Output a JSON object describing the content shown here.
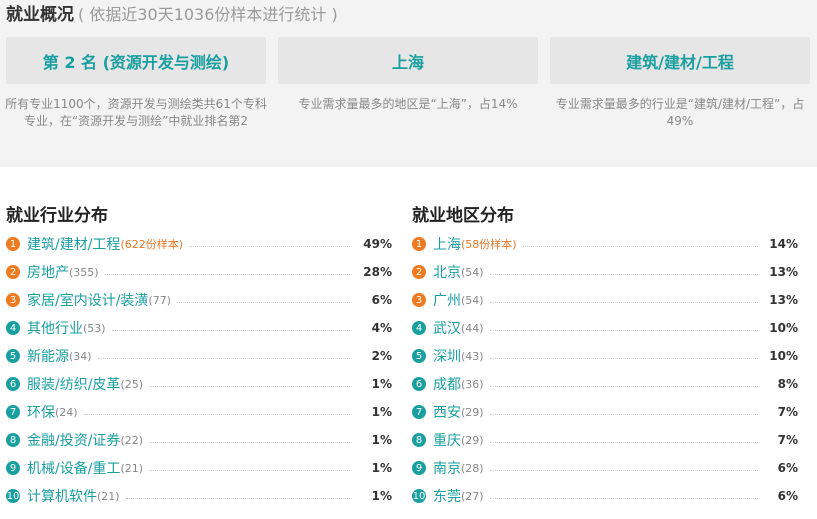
{
  "header": {
    "title": "就业概况",
    "subtitle": "( 依据近30天1036份样本进行统计 )"
  },
  "cards": [
    {
      "label": "第 2 名 (资源开发与测绘)",
      "desc": "所有专业1100个，资源开发与测绘类共61个专科专业，在“资源开发与测绘”中就业排名第2"
    },
    {
      "label": "上海",
      "desc": "专业需求量最多的地区是“上海”，占14%"
    },
    {
      "label": "建筑/建材/工程",
      "desc": "专业需求量最多的行业是“建筑/建材/工程”，占49%"
    }
  ],
  "industry": {
    "title": "就业行业分布",
    "items": [
      {
        "rank": "1",
        "name": "建筑/建材/工程",
        "count": "(622份样本)",
        "pct": "49%"
      },
      {
        "rank": "2",
        "name": "房地产",
        "count": "(355)",
        "pct": "28%"
      },
      {
        "rank": "3",
        "name": "家居/室内设计/装潢",
        "count": "(77)",
        "pct": "6%"
      },
      {
        "rank": "4",
        "name": "其他行业",
        "count": "(53)",
        "pct": "4%"
      },
      {
        "rank": "5",
        "name": "新能源",
        "count": "(34)",
        "pct": "2%"
      },
      {
        "rank": "6",
        "name": "服装/纺织/皮革",
        "count": "(25)",
        "pct": "1%"
      },
      {
        "rank": "7",
        "name": "环保",
        "count": "(24)",
        "pct": "1%"
      },
      {
        "rank": "8",
        "name": "金融/投资/证券",
        "count": "(22)",
        "pct": "1%"
      },
      {
        "rank": "9",
        "name": "机械/设备/重工",
        "count": "(21)",
        "pct": "1%"
      },
      {
        "rank": "10",
        "name": "计算机软件",
        "count": "(21)",
        "pct": "1%"
      }
    ]
  },
  "region": {
    "title": "就业地区分布",
    "items": [
      {
        "rank": "1",
        "name": "上海",
        "count": "(58份样本)",
        "pct": "14%"
      },
      {
        "rank": "2",
        "name": "北京",
        "count": "(54)",
        "pct": "13%"
      },
      {
        "rank": "3",
        "name": "广州",
        "count": "(54)",
        "pct": "13%"
      },
      {
        "rank": "4",
        "name": "武汉",
        "count": "(44)",
        "pct": "10%"
      },
      {
        "rank": "5",
        "name": "深圳",
        "count": "(43)",
        "pct": "10%"
      },
      {
        "rank": "6",
        "name": "成都",
        "count": "(36)",
        "pct": "8%"
      },
      {
        "rank": "7",
        "name": "西安",
        "count": "(29)",
        "pct": "7%"
      },
      {
        "rank": "8",
        "name": "重庆",
        "count": "(29)",
        "pct": "7%"
      },
      {
        "rank": "9",
        "name": "南京",
        "count": "(28)",
        "pct": "6%"
      },
      {
        "rank": "10",
        "name": "东莞",
        "count": "(27)",
        "pct": "6%"
      }
    ]
  },
  "colors": {
    "accent": "#1a9fa0",
    "rank_top": "#f07a1f",
    "count_highlight": "#e87722"
  }
}
